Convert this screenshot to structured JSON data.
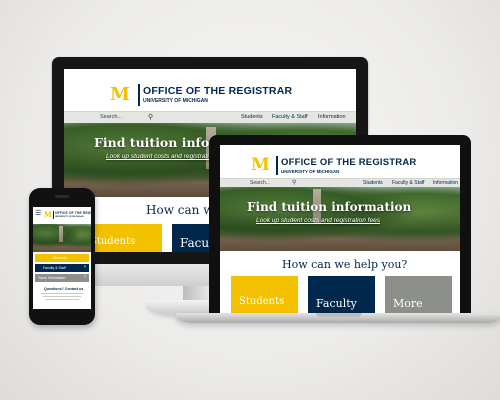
{
  "site": {
    "logo_letter": "M",
    "title": "OFFICE OF THE REGISTRAR",
    "subtitle": "UNIVERSITY OF MICHIGAN",
    "search_placeholder": "Search...",
    "nav": [
      "Students",
      "Faculty & Staff",
      "Information"
    ],
    "hero_title": "Find tuition information",
    "hero_subtitle": "Look up student costs and registration fees",
    "help_heading": "How can we help you?",
    "tiles": [
      {
        "label": "Students",
        "color": "#f4c100"
      },
      {
        "label": "Faculty",
        "color": "#00274c"
      },
      {
        "label": "More",
        "color": "#8d8f8a"
      }
    ],
    "carousel": {
      "count": 3,
      "active": 1
    }
  },
  "phone_menu": {
    "items": [
      "Students",
      "Faculty & Staff",
      "More Information"
    ],
    "questions_label": "Questions? Contact us"
  },
  "colors": {
    "maize": "#f4c100",
    "blue": "#00274c",
    "nav_bar": "#e4e6e1"
  },
  "icons": [
    "search-icon",
    "hamburger-icon",
    "chevron-right-icon"
  ]
}
